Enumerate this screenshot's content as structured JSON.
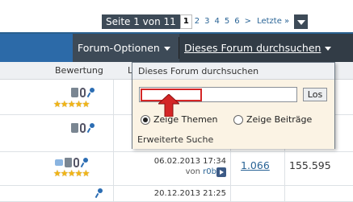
{
  "pagination": {
    "label": "Seite 1 von 11",
    "pages": [
      "1",
      "2",
      "3",
      "4",
      "5",
      "6"
    ],
    "current": "1",
    "next": ">",
    "last": "Letzte »"
  },
  "navbar": {
    "forum_options": "Forum-Optionen",
    "search_forum": "Dieses Forum durchsuchen"
  },
  "columns": {
    "rating": "Bewertung",
    "last_post_partial": "L"
  },
  "popup": {
    "title": "Dieses Forum durchsuchen",
    "query_value": "",
    "go_button": "Los",
    "radio_threads": "Zeige Themen",
    "radio_posts": "Zeige Beiträge",
    "advanced_search": "Erweiterte Suche",
    "selected": "threads"
  },
  "rows": [
    {
      "date": "",
      "user": "",
      "replies": "",
      "views": "",
      "stars": "★★★★★"
    },
    {
      "date": "",
      "user": "",
      "replies": "",
      "views": "",
      "stars": ""
    },
    {
      "date": "06.02.2013 17:34",
      "by_prefix": "von",
      "user": "r0b",
      "replies": "1.066",
      "views": "155.595",
      "stars": "★★★★★"
    },
    {
      "date": "20.12.2013 21:25",
      "user": "",
      "replies": "",
      "views": "",
      "stars": ""
    }
  ],
  "colors": {
    "navbar": "#3d4a57",
    "accent_blue": "#2c6aa8",
    "highlight_red": "#d42626",
    "popup_body": "#fbf3e4"
  }
}
